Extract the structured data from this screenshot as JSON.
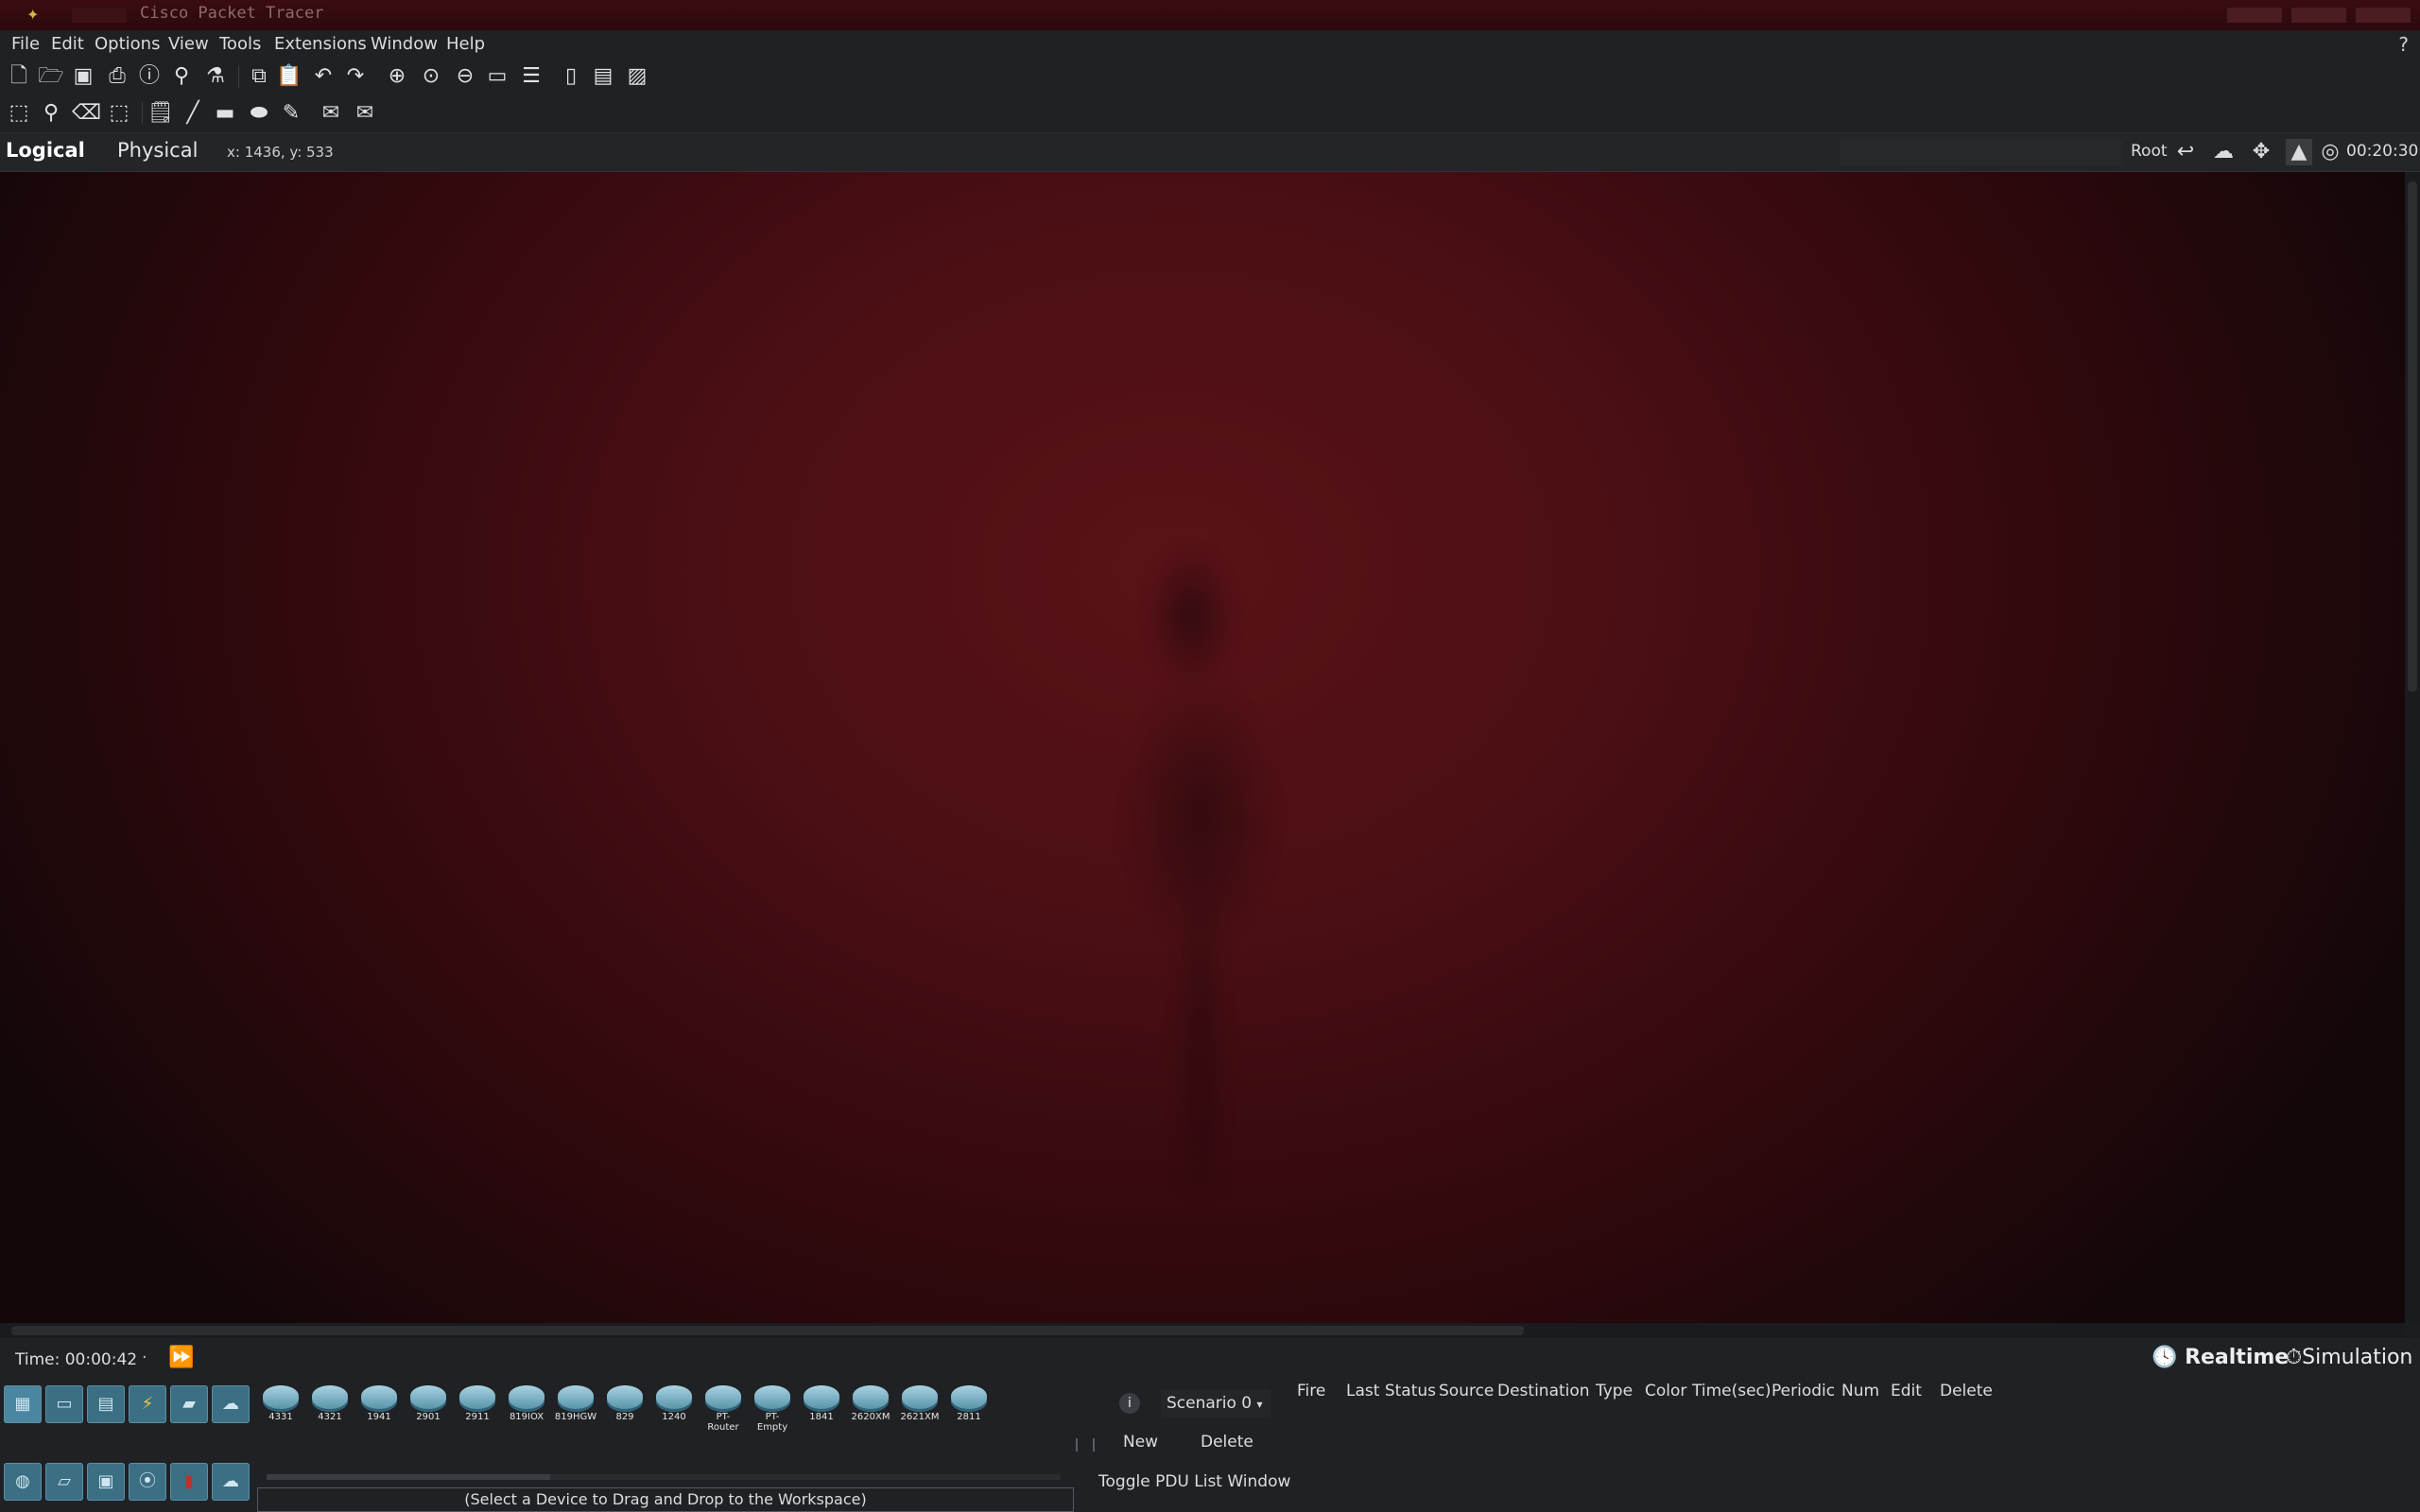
{
  "titlebar": {
    "title": "Cisco Packet Tracer"
  },
  "menubar": {
    "items": [
      "File",
      "Edit",
      "Options",
      "View",
      "Tools",
      "Extensions",
      "Window",
      "Help"
    ],
    "help": "?"
  },
  "viewbar": {
    "logical": "Logical",
    "physical": "Physical",
    "coords": "x: 1436, y: 533",
    "root": "Root",
    "clock": "00:20:30"
  },
  "bottom": {
    "time": "Time: 00:00:42",
    "realtime": "Realtime",
    "simulation": "Simulation"
  },
  "device_palette": {
    "devices": [
      "4331",
      "4321",
      "1941",
      "2901",
      "2911",
      "819IOX",
      "819HGW",
      "829",
      "1240",
      "PT-Router",
      "PT-Empty",
      "1841",
      "2620XM",
      "2621XM",
      "2811"
    ],
    "hint": "(Select a Device to Drag and Drop to the Workspace)"
  },
  "scenario": {
    "selected": "Scenario 0",
    "new": "New",
    "delete": "Delete",
    "toggle": "Toggle PDU List Window"
  },
  "pdu_columns": [
    "Fire",
    "Last Status",
    "Source",
    "Destination",
    "Type",
    "Color",
    "Time(sec)",
    "Periodic",
    "Num",
    "Edit",
    "Delete"
  ],
  "colors": {
    "workspace_center": "#5a1218",
    "workspace_edge": "#140709",
    "device_blue": "#4f8ca3"
  }
}
